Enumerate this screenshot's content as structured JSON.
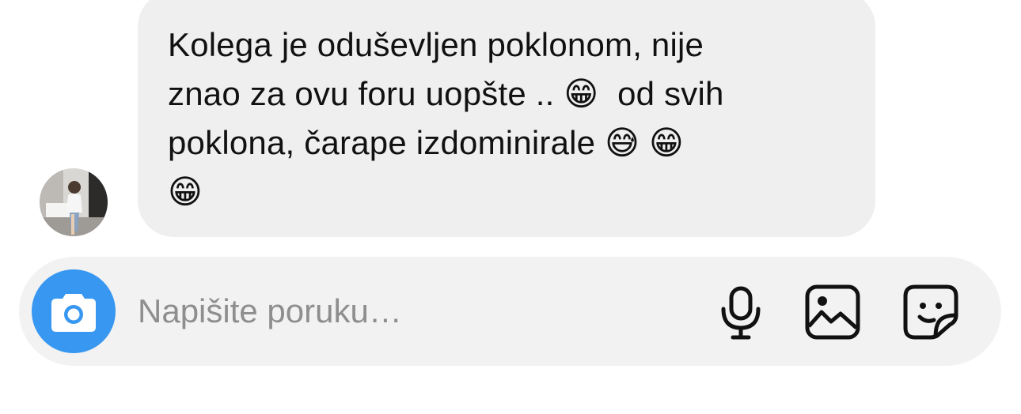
{
  "conversation": {
    "incoming_message": {
      "text": "Kolega je oduševljen poklonom, nije\nznao za ovu foru uopšte .. 😁  od svih\npoklona, čarape izdominirale 😅 😁\n😁"
    }
  },
  "composer": {
    "placeholder": "Napišite poruku…",
    "accent_color": "#3897f0",
    "icons": {
      "camera": "camera-icon",
      "microphone": "microphone-icon",
      "gallery": "image-gallery-icon",
      "sticker": "sticker-icon"
    }
  }
}
